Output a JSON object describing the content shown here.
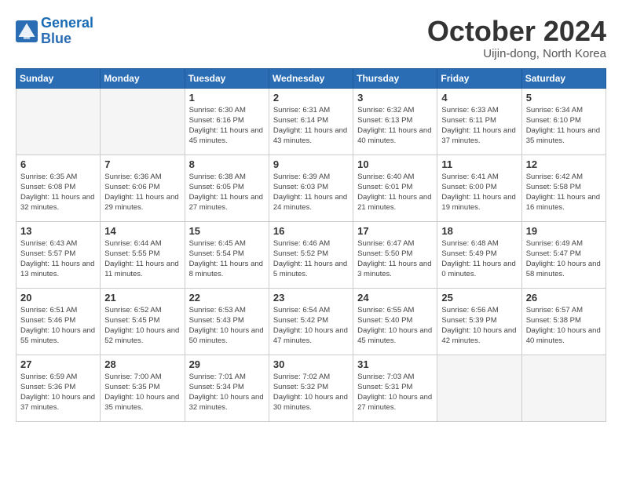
{
  "header": {
    "logo_line1": "General",
    "logo_line2": "Blue",
    "month_title": "October 2024",
    "subtitle": "Uijin-dong, North Korea"
  },
  "weekdays": [
    "Sunday",
    "Monday",
    "Tuesday",
    "Wednesday",
    "Thursday",
    "Friday",
    "Saturday"
  ],
  "weeks": [
    [
      {
        "day": "",
        "info": ""
      },
      {
        "day": "",
        "info": ""
      },
      {
        "day": "1",
        "info": "Sunrise: 6:30 AM\nSunset: 6:16 PM\nDaylight: 11 hours and 45 minutes."
      },
      {
        "day": "2",
        "info": "Sunrise: 6:31 AM\nSunset: 6:14 PM\nDaylight: 11 hours and 43 minutes."
      },
      {
        "day": "3",
        "info": "Sunrise: 6:32 AM\nSunset: 6:13 PM\nDaylight: 11 hours and 40 minutes."
      },
      {
        "day": "4",
        "info": "Sunrise: 6:33 AM\nSunset: 6:11 PM\nDaylight: 11 hours and 37 minutes."
      },
      {
        "day": "5",
        "info": "Sunrise: 6:34 AM\nSunset: 6:10 PM\nDaylight: 11 hours and 35 minutes."
      }
    ],
    [
      {
        "day": "6",
        "info": "Sunrise: 6:35 AM\nSunset: 6:08 PM\nDaylight: 11 hours and 32 minutes."
      },
      {
        "day": "7",
        "info": "Sunrise: 6:36 AM\nSunset: 6:06 PM\nDaylight: 11 hours and 29 minutes."
      },
      {
        "day": "8",
        "info": "Sunrise: 6:38 AM\nSunset: 6:05 PM\nDaylight: 11 hours and 27 minutes."
      },
      {
        "day": "9",
        "info": "Sunrise: 6:39 AM\nSunset: 6:03 PM\nDaylight: 11 hours and 24 minutes."
      },
      {
        "day": "10",
        "info": "Sunrise: 6:40 AM\nSunset: 6:01 PM\nDaylight: 11 hours and 21 minutes."
      },
      {
        "day": "11",
        "info": "Sunrise: 6:41 AM\nSunset: 6:00 PM\nDaylight: 11 hours and 19 minutes."
      },
      {
        "day": "12",
        "info": "Sunrise: 6:42 AM\nSunset: 5:58 PM\nDaylight: 11 hours and 16 minutes."
      }
    ],
    [
      {
        "day": "13",
        "info": "Sunrise: 6:43 AM\nSunset: 5:57 PM\nDaylight: 11 hours and 13 minutes."
      },
      {
        "day": "14",
        "info": "Sunrise: 6:44 AM\nSunset: 5:55 PM\nDaylight: 11 hours and 11 minutes."
      },
      {
        "day": "15",
        "info": "Sunrise: 6:45 AM\nSunset: 5:54 PM\nDaylight: 11 hours and 8 minutes."
      },
      {
        "day": "16",
        "info": "Sunrise: 6:46 AM\nSunset: 5:52 PM\nDaylight: 11 hours and 5 minutes."
      },
      {
        "day": "17",
        "info": "Sunrise: 6:47 AM\nSunset: 5:50 PM\nDaylight: 11 hours and 3 minutes."
      },
      {
        "day": "18",
        "info": "Sunrise: 6:48 AM\nSunset: 5:49 PM\nDaylight: 11 hours and 0 minutes."
      },
      {
        "day": "19",
        "info": "Sunrise: 6:49 AM\nSunset: 5:47 PM\nDaylight: 10 hours and 58 minutes."
      }
    ],
    [
      {
        "day": "20",
        "info": "Sunrise: 6:51 AM\nSunset: 5:46 PM\nDaylight: 10 hours and 55 minutes."
      },
      {
        "day": "21",
        "info": "Sunrise: 6:52 AM\nSunset: 5:45 PM\nDaylight: 10 hours and 52 minutes."
      },
      {
        "day": "22",
        "info": "Sunrise: 6:53 AM\nSunset: 5:43 PM\nDaylight: 10 hours and 50 minutes."
      },
      {
        "day": "23",
        "info": "Sunrise: 6:54 AM\nSunset: 5:42 PM\nDaylight: 10 hours and 47 minutes."
      },
      {
        "day": "24",
        "info": "Sunrise: 6:55 AM\nSunset: 5:40 PM\nDaylight: 10 hours and 45 minutes."
      },
      {
        "day": "25",
        "info": "Sunrise: 6:56 AM\nSunset: 5:39 PM\nDaylight: 10 hours and 42 minutes."
      },
      {
        "day": "26",
        "info": "Sunrise: 6:57 AM\nSunset: 5:38 PM\nDaylight: 10 hours and 40 minutes."
      }
    ],
    [
      {
        "day": "27",
        "info": "Sunrise: 6:59 AM\nSunset: 5:36 PM\nDaylight: 10 hours and 37 minutes."
      },
      {
        "day": "28",
        "info": "Sunrise: 7:00 AM\nSunset: 5:35 PM\nDaylight: 10 hours and 35 minutes."
      },
      {
        "day": "29",
        "info": "Sunrise: 7:01 AM\nSunset: 5:34 PM\nDaylight: 10 hours and 32 minutes."
      },
      {
        "day": "30",
        "info": "Sunrise: 7:02 AM\nSunset: 5:32 PM\nDaylight: 10 hours and 30 minutes."
      },
      {
        "day": "31",
        "info": "Sunrise: 7:03 AM\nSunset: 5:31 PM\nDaylight: 10 hours and 27 minutes."
      },
      {
        "day": "",
        "info": ""
      },
      {
        "day": "",
        "info": ""
      }
    ]
  ]
}
